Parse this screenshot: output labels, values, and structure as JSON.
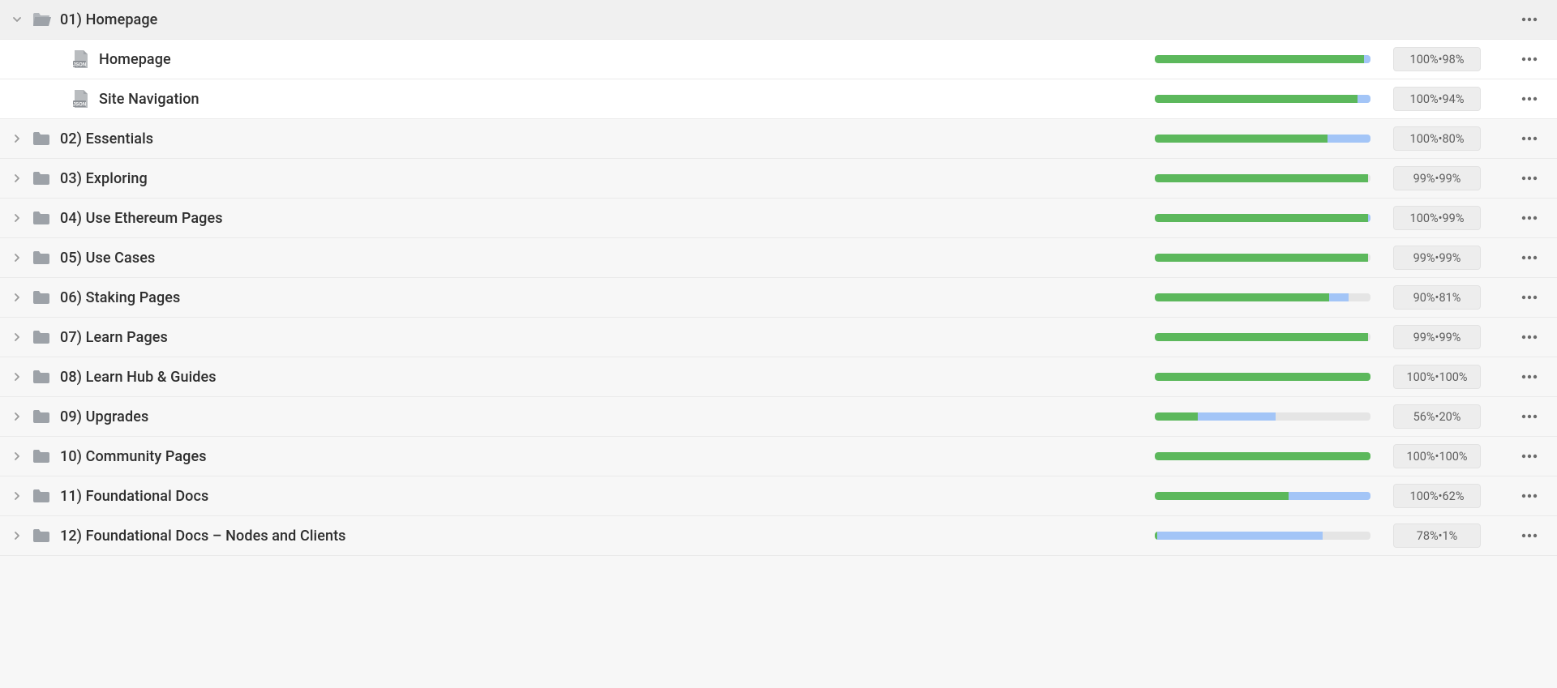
{
  "colors": {
    "green": "#5cb85c",
    "blue": "#a3c5f7",
    "grey": "#e5e5e5"
  },
  "rows": [
    {
      "type": "folder",
      "expanded": true,
      "indent": 0,
      "name": "01) Homepage",
      "hasStats": false
    },
    {
      "type": "file",
      "indent": 1,
      "name": "Homepage",
      "hasStats": true,
      "green": 97,
      "blue": 3,
      "stat1": "100%",
      "stat2": "98%"
    },
    {
      "type": "file",
      "indent": 1,
      "name": "Site Navigation",
      "hasStats": true,
      "green": 94,
      "blue": 6,
      "stat1": "100%",
      "stat2": "94%"
    },
    {
      "type": "folder",
      "expanded": false,
      "indent": 0,
      "name": "02) Essentials",
      "hasStats": true,
      "green": 80,
      "blue": 20,
      "stat1": "100%",
      "stat2": "80%"
    },
    {
      "type": "folder",
      "expanded": false,
      "indent": 0,
      "name": "03) Exploring",
      "hasStats": true,
      "green": 99,
      "blue": 0,
      "stat1": "99%",
      "stat2": "99%"
    },
    {
      "type": "folder",
      "expanded": false,
      "indent": 0,
      "name": "04) Use Ethereum Pages",
      "hasStats": true,
      "green": 99,
      "blue": 1,
      "stat1": "100%",
      "stat2": "99%"
    },
    {
      "type": "folder",
      "expanded": false,
      "indent": 0,
      "name": "05) Use Cases",
      "hasStats": true,
      "green": 99,
      "blue": 0,
      "stat1": "99%",
      "stat2": "99%"
    },
    {
      "type": "folder",
      "expanded": false,
      "indent": 0,
      "name": "06) Staking Pages",
      "hasStats": true,
      "green": 81,
      "blue": 9,
      "stat1": "90%",
      "stat2": "81%"
    },
    {
      "type": "folder",
      "expanded": false,
      "indent": 0,
      "name": "07) Learn Pages",
      "hasStats": true,
      "green": 99,
      "blue": 0,
      "stat1": "99%",
      "stat2": "99%"
    },
    {
      "type": "folder",
      "expanded": false,
      "indent": 0,
      "name": "08) Learn Hub & Guides",
      "hasStats": true,
      "green": 100,
      "blue": 0,
      "stat1": "100%",
      "stat2": "100%"
    },
    {
      "type": "folder",
      "expanded": false,
      "indent": 0,
      "name": "09) Upgrades",
      "hasStats": true,
      "green": 20,
      "blue": 36,
      "stat1": "56%",
      "stat2": "20%"
    },
    {
      "type": "folder",
      "expanded": false,
      "indent": 0,
      "name": "10) Community Pages",
      "hasStats": true,
      "green": 100,
      "blue": 0,
      "stat1": "100%",
      "stat2": "100%"
    },
    {
      "type": "folder",
      "expanded": false,
      "indent": 0,
      "name": "11) Foundational Docs",
      "hasStats": true,
      "green": 62,
      "blue": 38,
      "stat1": "100%",
      "stat2": "62%"
    },
    {
      "type": "folder",
      "expanded": false,
      "indent": 0,
      "name": "12) Foundational Docs – Nodes and Clients",
      "hasStats": true,
      "green": 1,
      "blue": 77,
      "stat1": "78%",
      "stat2": "1%"
    }
  ]
}
